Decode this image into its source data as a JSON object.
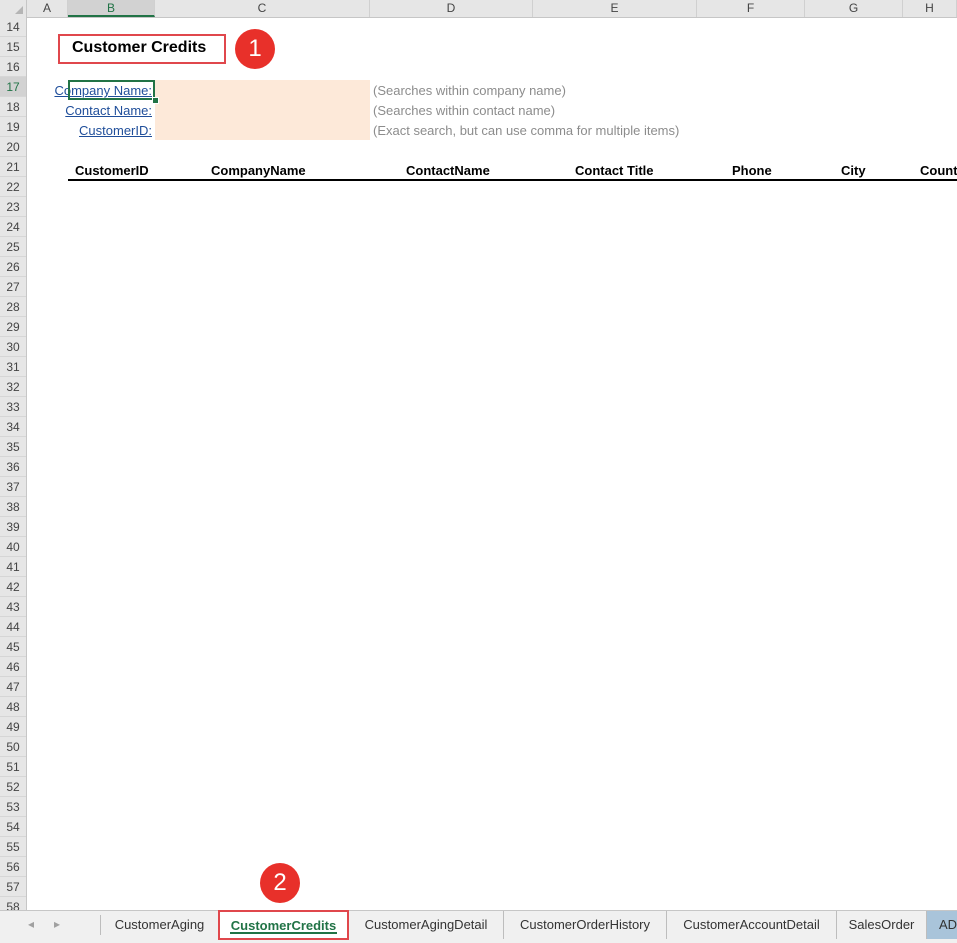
{
  "columns": [
    "A",
    "B",
    "C",
    "D",
    "E",
    "F",
    "G",
    "H"
  ],
  "rows": [
    "14",
    "15",
    "16",
    "17",
    "18",
    "19",
    "20",
    "21",
    "22",
    "23",
    "24",
    "25",
    "26",
    "27",
    "28",
    "29",
    "30",
    "31",
    "32",
    "33",
    "34",
    "35",
    "36",
    "37",
    "38",
    "39",
    "40",
    "41",
    "42",
    "43",
    "44",
    "45",
    "46",
    "47",
    "48",
    "49",
    "50",
    "51",
    "52",
    "53",
    "54",
    "55",
    "56",
    "57",
    "58"
  ],
  "sheet": {
    "title": "Customer Credits",
    "filters": [
      {
        "label": "Company Name:",
        "value": "",
        "hint": "(Searches within company name)"
      },
      {
        "label": "Contact Name:",
        "value": "",
        "hint": "(Searches within contact name)"
      },
      {
        "label": "CustomerID:",
        "value": "",
        "hint": "(Exact search, but can use comma for multiple items)"
      }
    ],
    "table_headers": [
      "CustomerID",
      "CompanyName",
      "ContactName",
      "Contact Title",
      "Phone",
      "City",
      "Count"
    ]
  },
  "annotations": {
    "badge1": "1",
    "badge2": "2"
  },
  "tabs": {
    "nav_prev": "◂",
    "nav_next": "▸",
    "items": [
      "CustomerAging",
      "CustomerCredits",
      "CustomerAgingDetail",
      "CustomerOrderHistory",
      "CustomerAccountDetail",
      "SalesOrder",
      "AD"
    ],
    "active": "CustomerCredits"
  },
  "colors": {
    "accent": "#217346",
    "annotation": "#e8302a",
    "input_fill": "#fde9d9",
    "link": "#1f4e9a"
  }
}
